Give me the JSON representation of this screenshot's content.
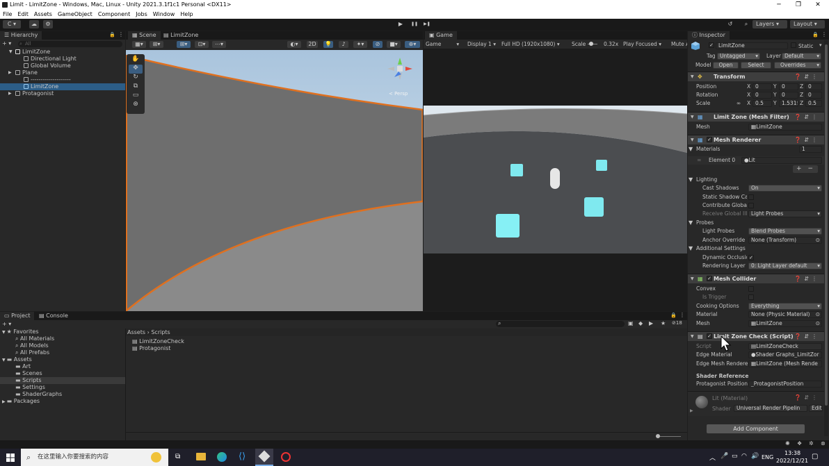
{
  "window": {
    "title": "Limit - LimitZone - Windows, Mac, Linux - Unity 2021.3.1f1c1 Personal <DX11>",
    "minimize": "─",
    "maximize": "❐",
    "close": "✕"
  },
  "menu": [
    "File",
    "Edit",
    "Assets",
    "GameObject",
    "Component",
    "Jobs",
    "Window",
    "Help"
  ],
  "toolbar": {
    "account": "C ▾",
    "cloud": "☁",
    "collab": "⚙",
    "play": "▶",
    "pause": "❚❚",
    "step": "▶❚",
    "history": "↺",
    "search": "⌕",
    "layers": "Layers",
    "layout": "Layout"
  },
  "hierarchy": {
    "tab": "Hierarchy",
    "add": "+ ▾",
    "search_placeholder": "All",
    "items": [
      {
        "label": "LimitZone",
        "depth": 0,
        "root": true
      },
      {
        "label": "Directional Light",
        "depth": 2
      },
      {
        "label": "Global Volume",
        "depth": 2
      },
      {
        "label": "Plane",
        "depth": 1
      },
      {
        "label": "--------------------",
        "depth": 2
      },
      {
        "label": "LimitZone",
        "depth": 2,
        "selected": true
      },
      {
        "label": "Protagonist",
        "depth": 1
      }
    ]
  },
  "scene": {
    "tab_scene": "Scene",
    "tab_asset": "LimitZone",
    "mode_2d": "2D",
    "persp": "< Persp"
  },
  "game": {
    "tab": "Game",
    "display_mode": "Game",
    "display": "Display 1",
    "resolution": "Full HD (1920x1080)",
    "scale_label": "Scale",
    "scale_value": "0.32x",
    "play_focused": "Play Focused",
    "mute": "Mute A"
  },
  "project": {
    "tab_project": "Project",
    "tab_console": "Console",
    "add": "+ ▾",
    "count": "18",
    "tree": [
      {
        "label": "Favorites",
        "depth": 0,
        "star": true
      },
      {
        "label": "All Materials",
        "depth": 1
      },
      {
        "label": "All Models",
        "depth": 1
      },
      {
        "label": "All Prefabs",
        "depth": 1
      },
      {
        "label": "Assets",
        "depth": 0,
        "folder": true
      },
      {
        "label": "Art",
        "depth": 1
      },
      {
        "label": "Scenes",
        "depth": 1
      },
      {
        "label": "Scripts",
        "depth": 1,
        "selected": true
      },
      {
        "label": "Settings",
        "depth": 1
      },
      {
        "label": "ShaderGraphs",
        "depth": 1
      },
      {
        "label": "Packages",
        "depth": 0,
        "folder": true
      }
    ],
    "breadcrumb": [
      "Assets",
      "Scripts"
    ],
    "files": [
      "LimitZoneCheck",
      "Protagonist"
    ]
  },
  "inspector": {
    "tab": "Inspector",
    "object_name": "LimitZone",
    "static": "Static",
    "tag_label": "Tag",
    "tag": "Untagged",
    "layer_label": "Layer",
    "layer": "Default",
    "model_label": "Model",
    "open": "Open",
    "select": "Select",
    "overrides": "Overrides",
    "transform": {
      "title": "Transform",
      "position": {
        "label": "Position",
        "x": "0",
        "y": "0",
        "z": "0"
      },
      "rotation": {
        "label": "Rotation",
        "x": "0",
        "y": "0",
        "z": "0"
      },
      "scale": {
        "label": "Scale",
        "x": "0.5",
        "y": "1.531!",
        "z": "0.5"
      }
    },
    "mesh_filter": {
      "title": "Limit Zone (Mesh Filter)",
      "mesh_label": "Mesh",
      "mesh": "LimitZone"
    },
    "mesh_renderer": {
      "title": "Mesh Renderer",
      "materials": "Materials",
      "materials_count": "1",
      "element0": "Element 0",
      "element0_value": "Lit",
      "lighting": "Lighting",
      "cast_shadows": "Cast Shadows",
      "cast_shadows_value": "On",
      "static_shadow": "Static Shadow Cas",
      "contribute_gi": "Contribute Global I",
      "receive_gi": "Receive Global Illu",
      "receive_gi_value": "Light Probes",
      "probes": "Probes",
      "light_probes": "Light Probes",
      "light_probes_value": "Blend Probes",
      "anchor_override": "Anchor Override",
      "anchor_value": "None (Transform)",
      "additional": "Additional Settings",
      "dynamic_occlusion": "Dynamic Occlusio",
      "rendering_layer": "Rendering Layer M",
      "rendering_layer_value": "0: Light Layer default"
    },
    "mesh_collider": {
      "title": "Mesh Collider",
      "convex": "Convex",
      "is_trigger": "Is Trigger",
      "cooking": "Cooking Options",
      "cooking_value": "Everything",
      "material": "Material",
      "material_value": "None (Physic Material)",
      "mesh": "Mesh",
      "mesh_value": "LimitZone"
    },
    "limit_check": {
      "title": "Limit Zone Check (Script)",
      "script": "Script",
      "script_value": "LimitZoneCheck",
      "edge_material": "Edge Material",
      "edge_material_value": "Shader Graphs_LimitZor",
      "edge_renderer": "Edge Mesh Renderer",
      "edge_renderer_value": "LimitZone (Mesh Rende",
      "shader_ref": "Shader Reference",
      "prot_pos": "Protagonist Position",
      "prot_pos_value": "_ProtagonistPosition"
    },
    "material": {
      "name": "Lit (Material)",
      "shader_label": "Shader",
      "shader": "Universal Render Pipelin",
      "edit": "Edit..."
    },
    "add_component": "Add Component"
  },
  "taskbar": {
    "search": "在这里输入你要搜索的内容",
    "lang": "ENG",
    "time": "13:38",
    "date": "2022/12/21"
  },
  "colors": {
    "selection": "#2c5d87",
    "edge": "#e0701f",
    "sky": "#dfe9f2",
    "ground": "#4b4d50",
    "cube": "#8ff3f7"
  }
}
